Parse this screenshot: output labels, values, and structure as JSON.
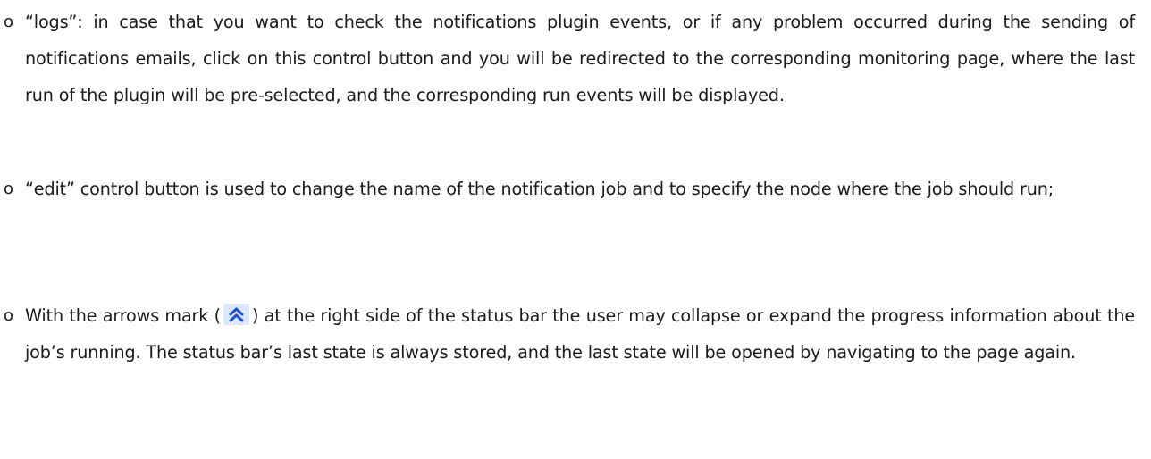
{
  "items": [
    {
      "marker": "o",
      "text": "“logs”: in case that you want to check the notifications plugin events, or if any problem occurred during the sending of notifications emails, click on this control button and you will be redirected to the corresponding monitoring page, where the last run of the plugin will be pre-selected, and the corresponding run events will be displayed."
    },
    {
      "marker": "o",
      "text": "“edit” control button is used to change the name of the notification job and to specify the node where the job should run;"
    },
    {
      "marker": "o",
      "text_before_icon": "With the arrows mark (",
      "icon": "double-chevron-up-icon",
      "text_after_icon": ") at the right side of the status bar the user may collapse or expand the progress information about the job’s running. The status bar’s last state is always stored, and the last state will be opened by navigating to the page again."
    }
  ],
  "colors": {
    "text": "#1a1a1a",
    "icon_background": "#dbe7fb",
    "icon_arrow": "#1f4fd6"
  }
}
